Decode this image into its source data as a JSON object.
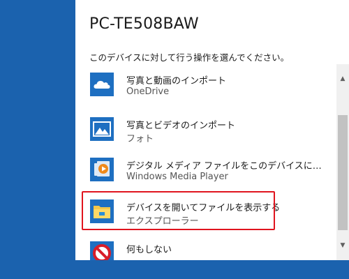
{
  "dialog": {
    "title": "PC-TE508BAW",
    "prompt": "このデバイスに対して行う操作を選んでください。"
  },
  "items": [
    {
      "label": "写真と動画のインポート",
      "sub": "OneDrive",
      "icon": "onedrive-cloud-icon"
    },
    {
      "label": "写真とビデオのインポート",
      "sub": "フォト",
      "icon": "photos-icon"
    },
    {
      "label": "デジタル メディア ファイルをこのデバイスに同期さ...",
      "sub": "Windows Media Player",
      "icon": "windows-media-player-icon"
    },
    {
      "label": "デバイスを開いてファイルを表示する",
      "sub": "エクスプローラー",
      "icon": "file-explorer-icon"
    },
    {
      "label": "何もしない",
      "sub": "",
      "icon": "no-action-icon"
    }
  ],
  "colors": {
    "desktop": "#1b62ae",
    "tile_blue": "#1e6fc1",
    "highlight": "#e0141e"
  }
}
